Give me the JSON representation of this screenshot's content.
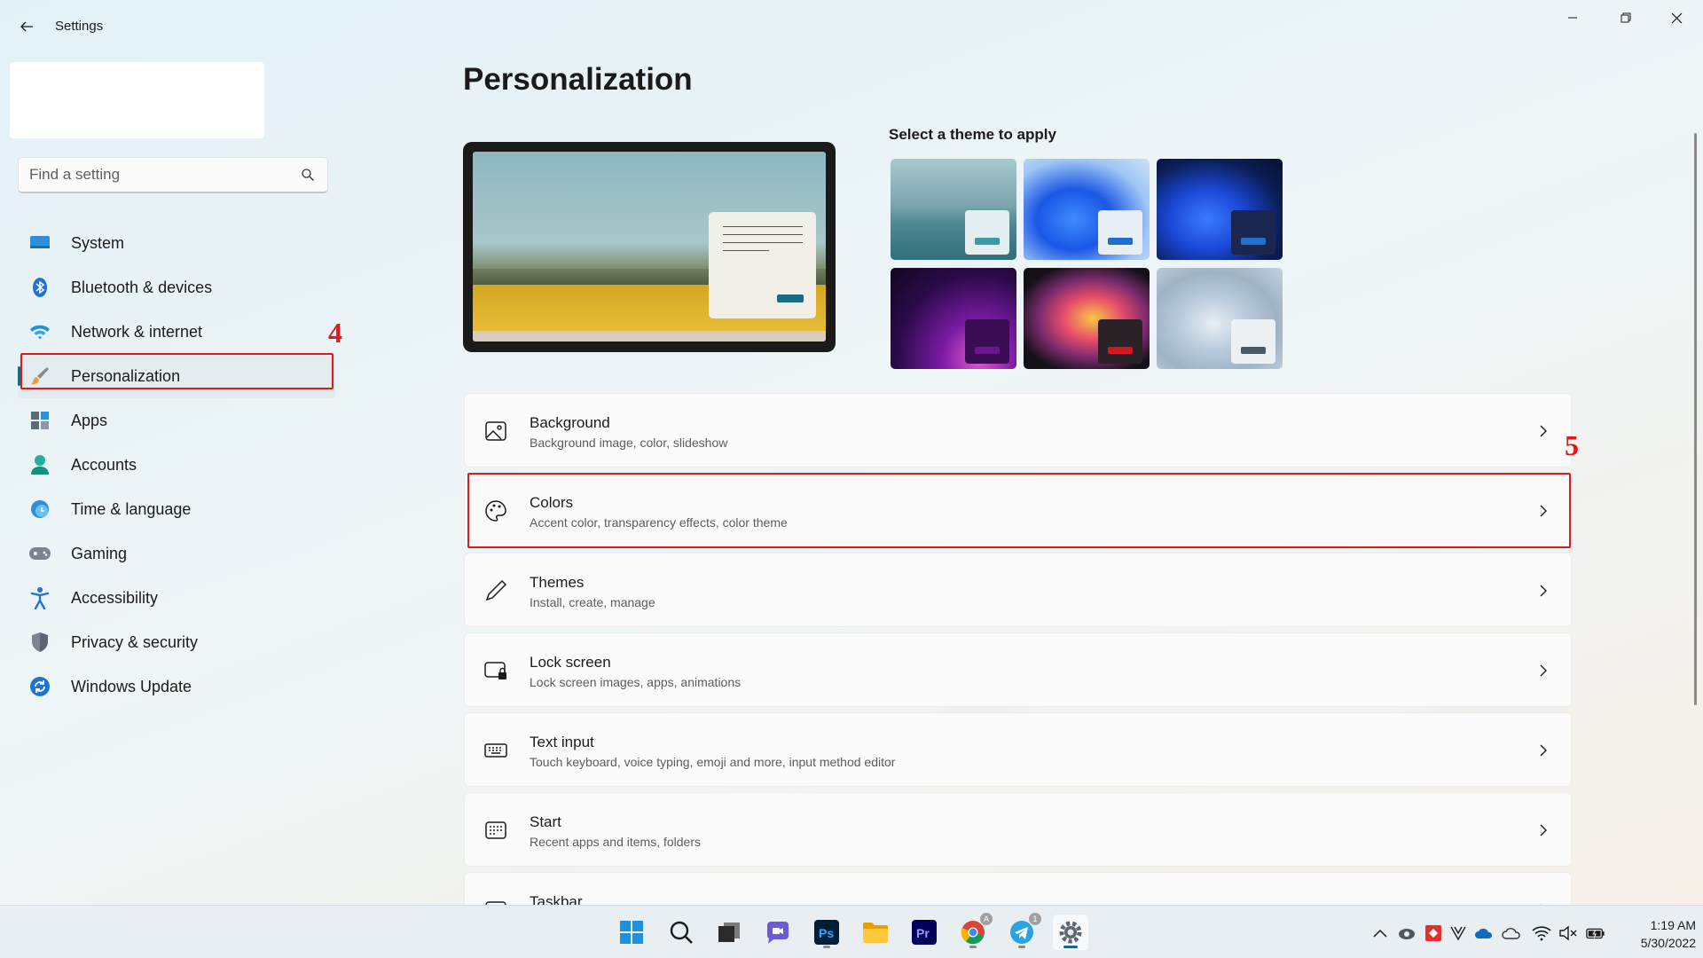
{
  "window": {
    "title": "Settings"
  },
  "search": {
    "placeholder": "Find a setting"
  },
  "sidebar": {
    "items": [
      {
        "label": "System",
        "icon": "monitor-icon"
      },
      {
        "label": "Bluetooth & devices",
        "icon": "bluetooth-icon"
      },
      {
        "label": "Network & internet",
        "icon": "wifi-icon"
      },
      {
        "label": "Personalization",
        "icon": "brush-icon",
        "active": true
      },
      {
        "label": "Apps",
        "icon": "apps-icon"
      },
      {
        "label": "Accounts",
        "icon": "person-icon"
      },
      {
        "label": "Time & language",
        "icon": "clock-globe-icon"
      },
      {
        "label": "Gaming",
        "icon": "gamepad-icon"
      },
      {
        "label": "Accessibility",
        "icon": "accessibility-icon"
      },
      {
        "label": "Privacy & security",
        "icon": "shield-icon"
      },
      {
        "label": "Windows Update",
        "icon": "update-icon"
      }
    ]
  },
  "annotations": {
    "step4": "4",
    "step5": "5",
    "color": "#e01a1a"
  },
  "main": {
    "title": "Personalization",
    "themes_title": "Select a theme to apply",
    "themes": [
      {
        "name": "theme-lake",
        "accent": "#3c9aa8"
      },
      {
        "name": "theme-bloom-light",
        "accent": "#1f6fd0"
      },
      {
        "name": "theme-bloom-dark",
        "accent": "#1f6fd0"
      },
      {
        "name": "theme-glow",
        "accent": "#6a1592"
      },
      {
        "name": "theme-captured-motion",
        "accent": "#d4161f"
      },
      {
        "name": "theme-flow",
        "accent": "#4a5967"
      }
    ],
    "cards": [
      {
        "title": "Background",
        "sub": "Background image, color, slideshow",
        "icon": "image-icon"
      },
      {
        "title": "Colors",
        "sub": "Accent color, transparency effects, color theme",
        "icon": "palette-icon"
      },
      {
        "title": "Themes",
        "sub": "Install, create, manage",
        "icon": "pen-icon"
      },
      {
        "title": "Lock screen",
        "sub": "Lock screen images, apps, animations",
        "icon": "lock-screen-icon"
      },
      {
        "title": "Text input",
        "sub": "Touch keyboard, voice typing, emoji and more, input method editor",
        "icon": "keyboard-icon"
      },
      {
        "title": "Start",
        "sub": "Recent apps and items, folders",
        "icon": "start-icon"
      },
      {
        "title": "Taskbar",
        "sub": "",
        "icon": "taskbar-icon"
      }
    ]
  },
  "taskbar": {
    "time": "1:19 AM",
    "date": "5/30/2022",
    "badges": {
      "chrome": "A",
      "telegram": "1"
    },
    "apps": [
      "windows-start-icon",
      "search-icon",
      "task-view-icon",
      "chat-icon",
      "photoshop-icon",
      "file-explorer-icon",
      "premiere-icon",
      "chrome-icon",
      "telegram-icon",
      "settings-icon"
    ],
    "ps_label": "Ps",
    "pr_label": "Pr"
  },
  "colors": {
    "accent": "#1a6b82"
  }
}
